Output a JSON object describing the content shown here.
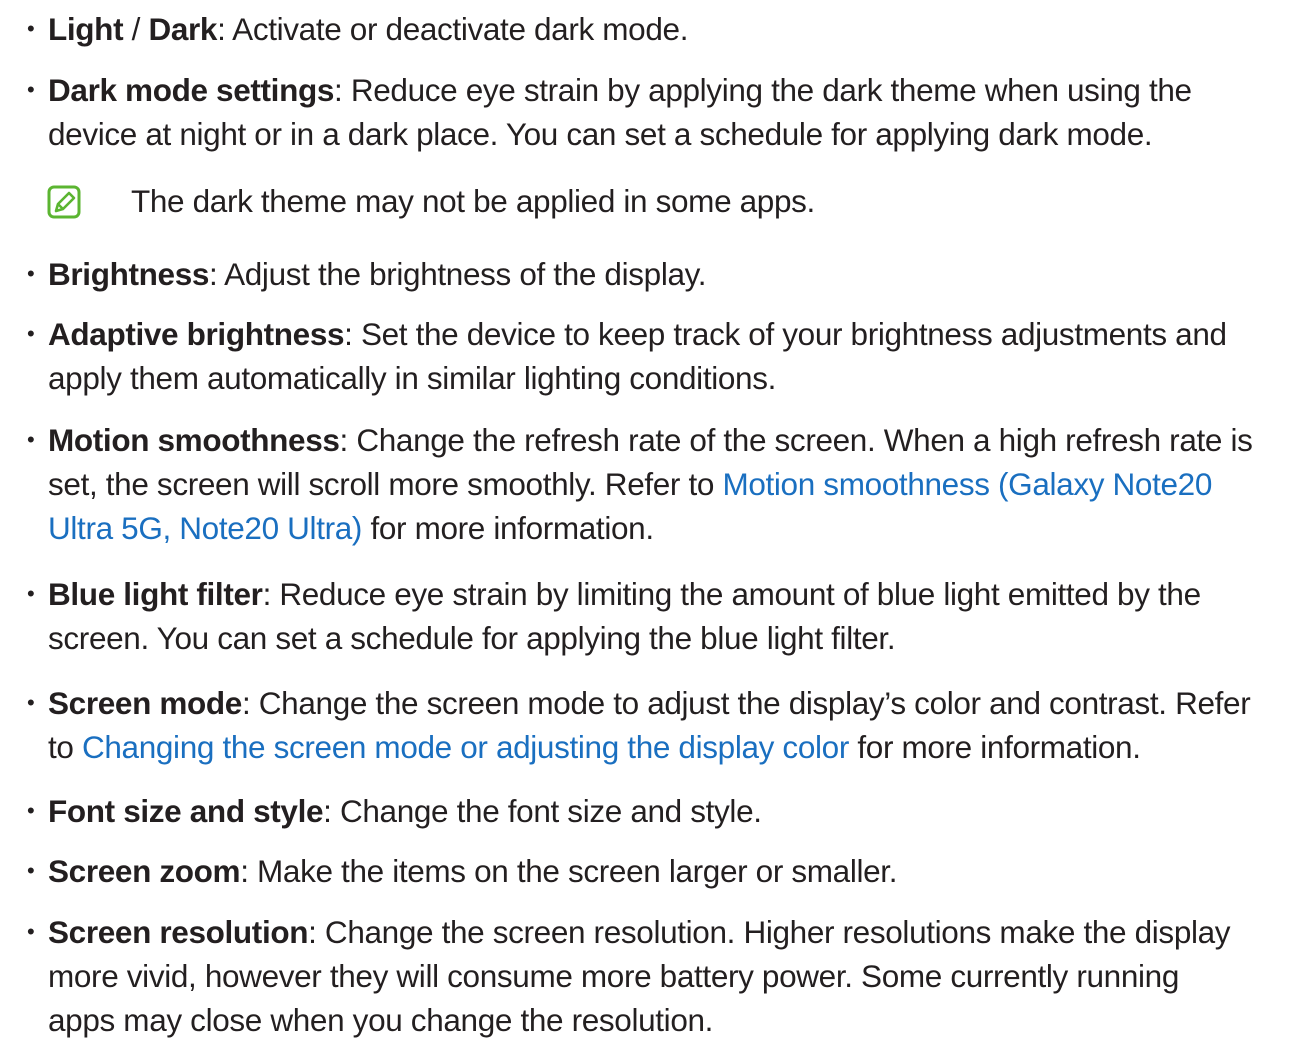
{
  "items": [
    {
      "term": "Light",
      "sep": " / ",
      "term2": "Dark",
      "desc": ": Activate or deactivate dark mode."
    },
    {
      "term": "Dark mode settings",
      "l1": ": Reduce eye strain by applying the dark theme when using the",
      "l2": "device at night or in a dark place. You can set a schedule for applying dark mode."
    },
    {
      "term": "Brightness",
      "desc": ": Adjust the brightness of the display."
    },
    {
      "term": "Adaptive brightness",
      "l1": ": Set the device to keep track of your brightness adjustments and",
      "l2": "apply them automatically in similar lighting conditions."
    },
    {
      "term": "Motion smoothness",
      "l1": ": Change the refresh rate of the screen. When a high refresh rate is",
      "l2_pre": "set, the screen will scroll more smoothly. Refer to ",
      "link_l2": "Motion smoothness (Galaxy Note20",
      "link_l3": "Ultra 5G, Note20 Ultra)",
      "l3_post": " for more information."
    },
    {
      "term": "Blue light filter",
      "l1": ": Reduce eye strain by limiting the amount of blue light emitted by the",
      "l2": "screen. You can set a schedule for applying the blue light filter."
    },
    {
      "term": "Screen mode",
      "l1": ": Change the screen mode to adjust the display’s color and contrast. Refer",
      "l2_pre": "to ",
      "link": "Changing the screen mode or adjusting the display color",
      "l2_post": " for more information."
    },
    {
      "term": "Font size and style",
      "desc": ": Change the font size and style."
    },
    {
      "term": "Screen zoom",
      "desc": ": Make the items on the screen larger or smaller."
    },
    {
      "term": "Screen resolution",
      "l1": ": Change the screen resolution. Higher resolutions make the display",
      "l2": "more vivid, however they will consume more battery power. Some currently running",
      "l3": "apps may close when you change the resolution."
    }
  ],
  "note": {
    "icon": "note-pencil-icon",
    "text": "The dark theme may not be applied in some apps."
  },
  "bullet_char": "•",
  "colors": {
    "text": "#231f20",
    "link": "#1a6fc0",
    "note_icon": "#5bb531"
  }
}
